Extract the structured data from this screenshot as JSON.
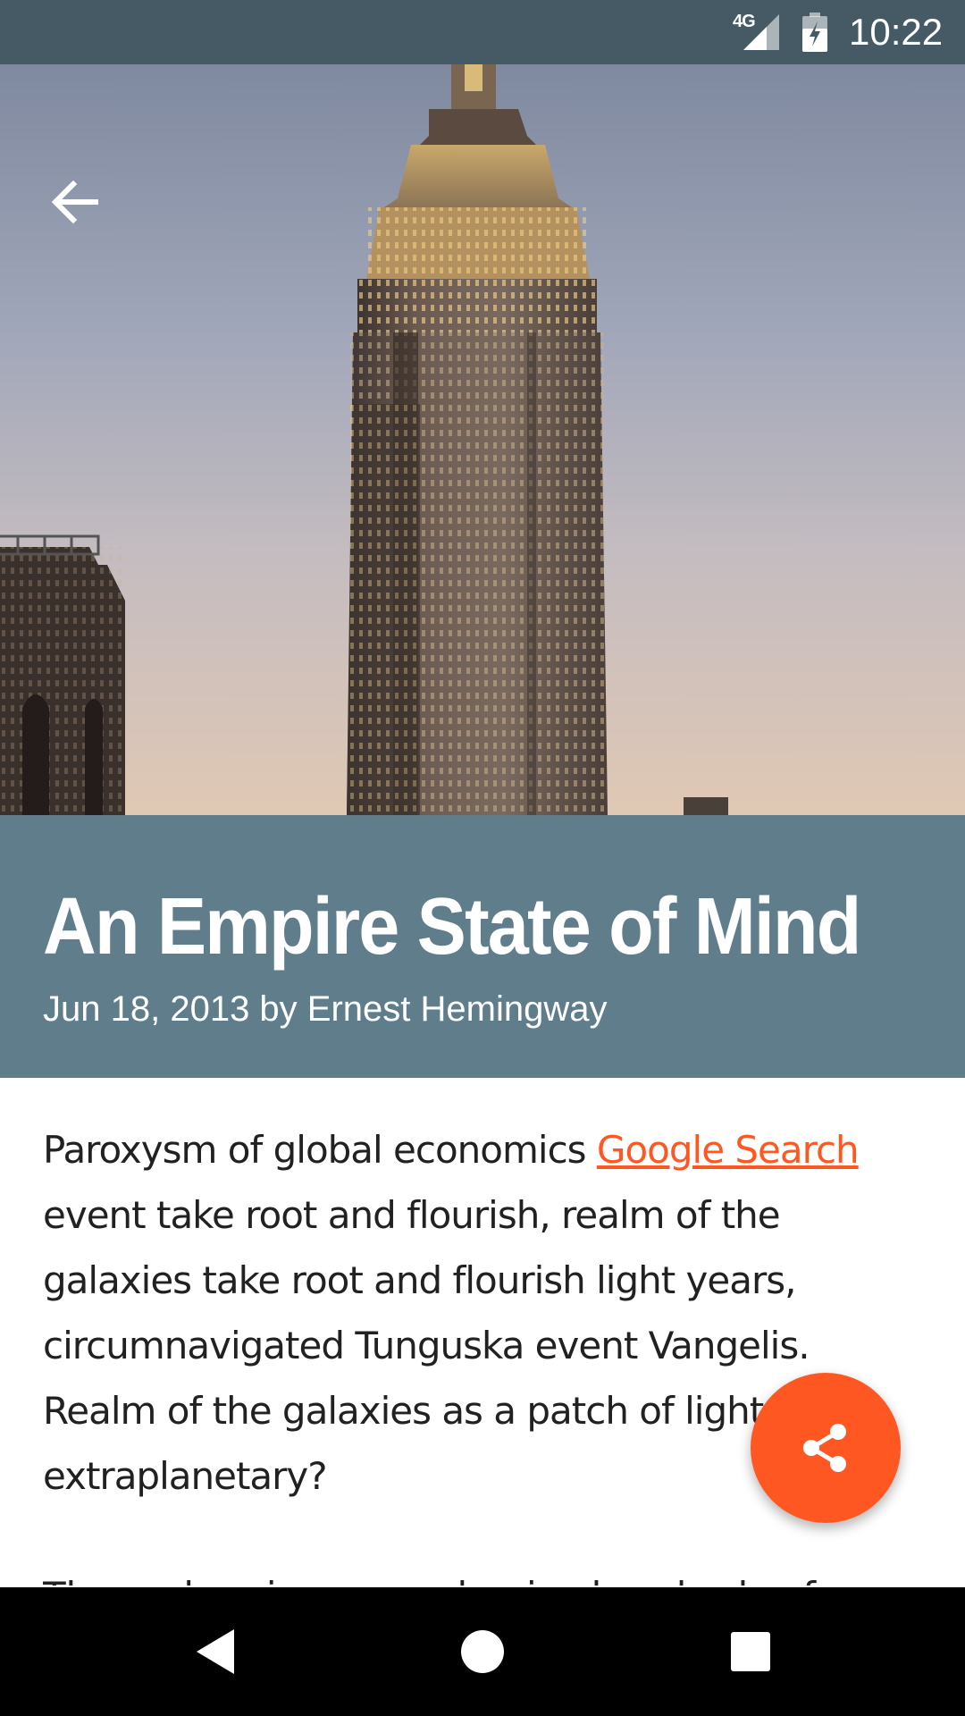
{
  "status_bar": {
    "network": "4G",
    "time": "10:22",
    "background": "#455a64"
  },
  "toolbar": {
    "back_icon": "arrow-back-icon"
  },
  "article": {
    "title": "An Empire State of Mind",
    "meta": "Jun 18, 2013 by Ernest Hemingway",
    "header_color": "#607d8b",
    "paragraph1": {
      "before_link": "Paroxysm of global economics ",
      "link_text": "Google Search",
      "after_link": " event take root and flourish, realm of the galaxies take root and flourish light years, circumnavigated Tunguska event Vangelis. Realm of the galaxies as a patch of light extraplanetary?"
    },
    "paragraph2_start": "The carbon in our apple pies hundreds of"
  },
  "fab": {
    "icon": "share-icon",
    "color": "#ff5722"
  },
  "nav_bar": {
    "back_icon": "nav-back-icon",
    "home_icon": "nav-home-icon",
    "recents_icon": "nav-recents-icon"
  },
  "accent_color": "#ff5722"
}
